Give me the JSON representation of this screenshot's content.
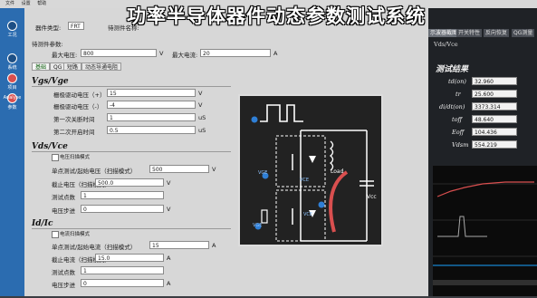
{
  "menubar": {
    "items": [
      "文件",
      "设置",
      "帮助"
    ]
  },
  "overlay_title": "功率半导体器件动态参数测试系统",
  "sidebar": {
    "items": [
      {
        "label": "工况",
        "icon": "home-icon"
      },
      {
        "label": "系统",
        "icon": "system-icon"
      },
      {
        "label": "项目",
        "icon": "project-icon"
      },
      {
        "label": "参数",
        "icon": "param-icon"
      },
      {
        "label": "Analyse",
        "icon": "analyse-icon"
      }
    ]
  },
  "header": {
    "device_type_label": "器件类型:",
    "device_type_value": "FRT",
    "device_name_label": "待测件名称:",
    "device_params_label": "待测件参数:",
    "max_current_label": "最大电流:",
    "max_current_value": "20",
    "max_current_unit": "A",
    "max_voltage_label": "最大电压:",
    "max_voltage_value": "800",
    "max_voltage_unit": "V"
  },
  "tabs": [
    "基础",
    "QG",
    "短路",
    "动态导通电阻"
  ],
  "vgs": {
    "title": "Vgs/Vge",
    "rows": [
      {
        "label": "栅极驱动电压（+）",
        "value": "15",
        "unit": "V"
      },
      {
        "label": "栅极驱动电压（-）",
        "value": "-4",
        "unit": "V"
      },
      {
        "label": "第一次关断时间",
        "value": "1",
        "unit": "uS"
      },
      {
        "label": "第二次开启时间",
        "value": "0.5",
        "unit": "uS"
      }
    ]
  },
  "vds": {
    "title": "Vds/Vce",
    "checkbox_label": "电压扫描模式",
    "rows": [
      {
        "label": "单点测试/起始电压（扫描模式）",
        "value": "500",
        "unit": "V"
      },
      {
        "label": "截止电压（扫描模式）",
        "value": "500.0",
        "unit": "V"
      },
      {
        "label": "测试点数",
        "value": "1",
        "unit": ""
      },
      {
        "label": "电压步进",
        "value": "0",
        "unit": "V"
      }
    ]
  },
  "id": {
    "title": "Id/Ic",
    "checkbox_label": "电流扫描模式",
    "rows": [
      {
        "label": "单点测试/起始电流（扫描模式）",
        "value": "15",
        "unit": "A"
      },
      {
        "label": "截止电流（扫描模式）",
        "value": "15.0",
        "unit": "A"
      },
      {
        "label": "测试点数",
        "value": "1",
        "unit": ""
      },
      {
        "label": "电压步进",
        "value": "0",
        "unit": "A"
      }
    ]
  },
  "right": {
    "top_label": "Vds/Vce",
    "tabs": [
      "示波器截图",
      "开关特性",
      "反向恢复",
      "QG测量"
    ],
    "results_title": "测试结果",
    "results": [
      {
        "label": "td(on)",
        "value": "32.960"
      },
      {
        "label": "tr",
        "value": "25.600"
      },
      {
        "label": "di/dt(on)",
        "value": "3373.314"
      },
      {
        "label": "toff",
        "value": "48.640"
      },
      {
        "label": "Eoff",
        "value": "104.436"
      },
      {
        "label": "Vdsm",
        "value": "554.219"
      }
    ],
    "right_units": [
      "ns",
      "ns",
      "A/us",
      "ns",
      "uJ",
      "V"
    ]
  },
  "diagram": {
    "load_label": "Load",
    "vcc_label": "Vcc",
    "v_labels": [
      "VGE",
      "VCE",
      "VGE",
      "VCE"
    ]
  },
  "colors": {
    "sidebar": "#2b6cb0",
    "panel": "#d7d7d7",
    "scope_trace": "#d94f4f"
  }
}
